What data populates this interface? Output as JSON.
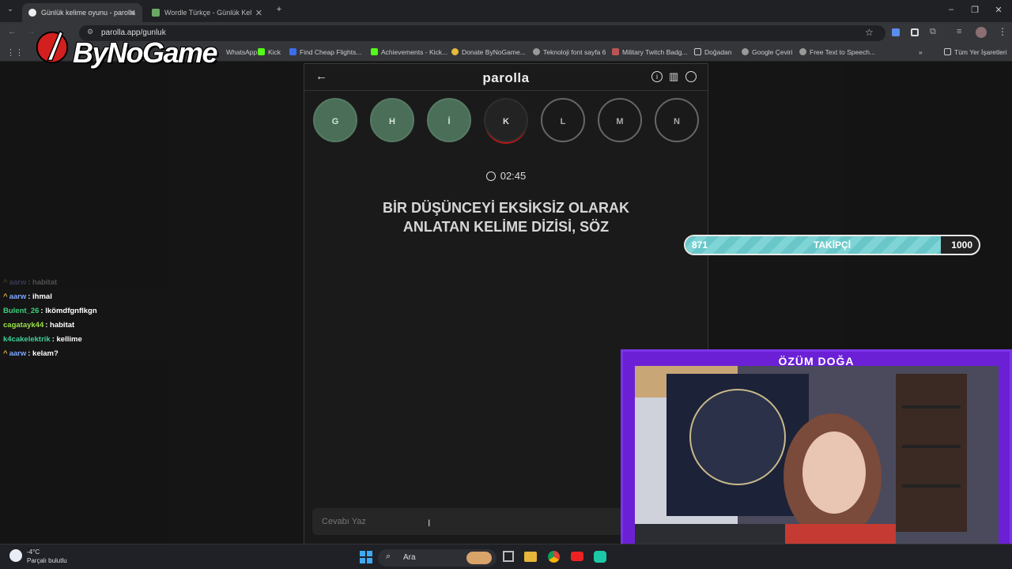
{
  "browser": {
    "tabs": [
      {
        "title": "Günlük kelime oyunu - parolla",
        "active": true
      },
      {
        "title": "Wordle Türkçe - Günlük Kelime",
        "active": false
      }
    ],
    "url": "parolla.app/gunluk",
    "bookmarks": [
      "WhatsApp",
      "Kick",
      "Find Cheap Flights...",
      "Achievements - Kick...",
      "Donate ByNoGame...",
      "Teknoloji font sayfa 6",
      "Military Twitch Badg...",
      "Doğadan",
      "Google Çeviri",
      "Free Text to Speech..."
    ],
    "all_bookmarks": "Tüm Yer İşaretleri"
  },
  "logo": {
    "text": "ByNoGame"
  },
  "game": {
    "title": "parolla",
    "letters": [
      {
        "letter": "G",
        "state": "done"
      },
      {
        "letter": "H",
        "state": "done"
      },
      {
        "letter": "İ",
        "state": "done"
      },
      {
        "letter": "K",
        "state": "active"
      },
      {
        "letter": "L",
        "state": "pending"
      },
      {
        "letter": "M",
        "state": "pending"
      },
      {
        "letter": "N",
        "state": "pending"
      }
    ],
    "timer": "02:45",
    "question_line1": "BİR DÜŞÜNCEYİ EKSİKSİZ OLARAK",
    "question_line2": "ANLATAN KELİME DİZİSİ, SÖZ",
    "answer_placeholder": "Cevabı Yaz",
    "colors": {
      "done": "#4a6e58",
      "active_ring": "#b31818"
    }
  },
  "follower_goal": {
    "current": "871",
    "label": "TAKİPÇİ",
    "target": "1000",
    "progress": 0.871
  },
  "chat": [
    {
      "user": "aarw",
      "message": "habitat",
      "crown": true,
      "faded": true,
      "color": "#9aa7ff"
    },
    {
      "user": "aarw",
      "message": "ihmal",
      "crown": true,
      "faded": false,
      "color": "#7fa7ff"
    },
    {
      "user": "Bulent_26",
      "message": "lkömdfgnflkgn",
      "crown": false,
      "faded": false,
      "color": "#3ed07a"
    },
    {
      "user": "cagatayk44",
      "message": "habitat",
      "crown": false,
      "faded": false,
      "color": "#9be04a"
    },
    {
      "user": "k4cakelektrik",
      "message": "kellime",
      "crown": false,
      "faded": false,
      "color": "#3ed09a"
    },
    {
      "user": "aarw",
      "message": "kelam?",
      "crown": true,
      "faded": false,
      "color": "#7fa7ff"
    }
  ],
  "webcam": {
    "name": "ÖZÜM DOĞA"
  },
  "taskbar": {
    "weather_temp": "-4°C",
    "weather_desc": "Parçalı bulutlu",
    "search": "Ara"
  }
}
